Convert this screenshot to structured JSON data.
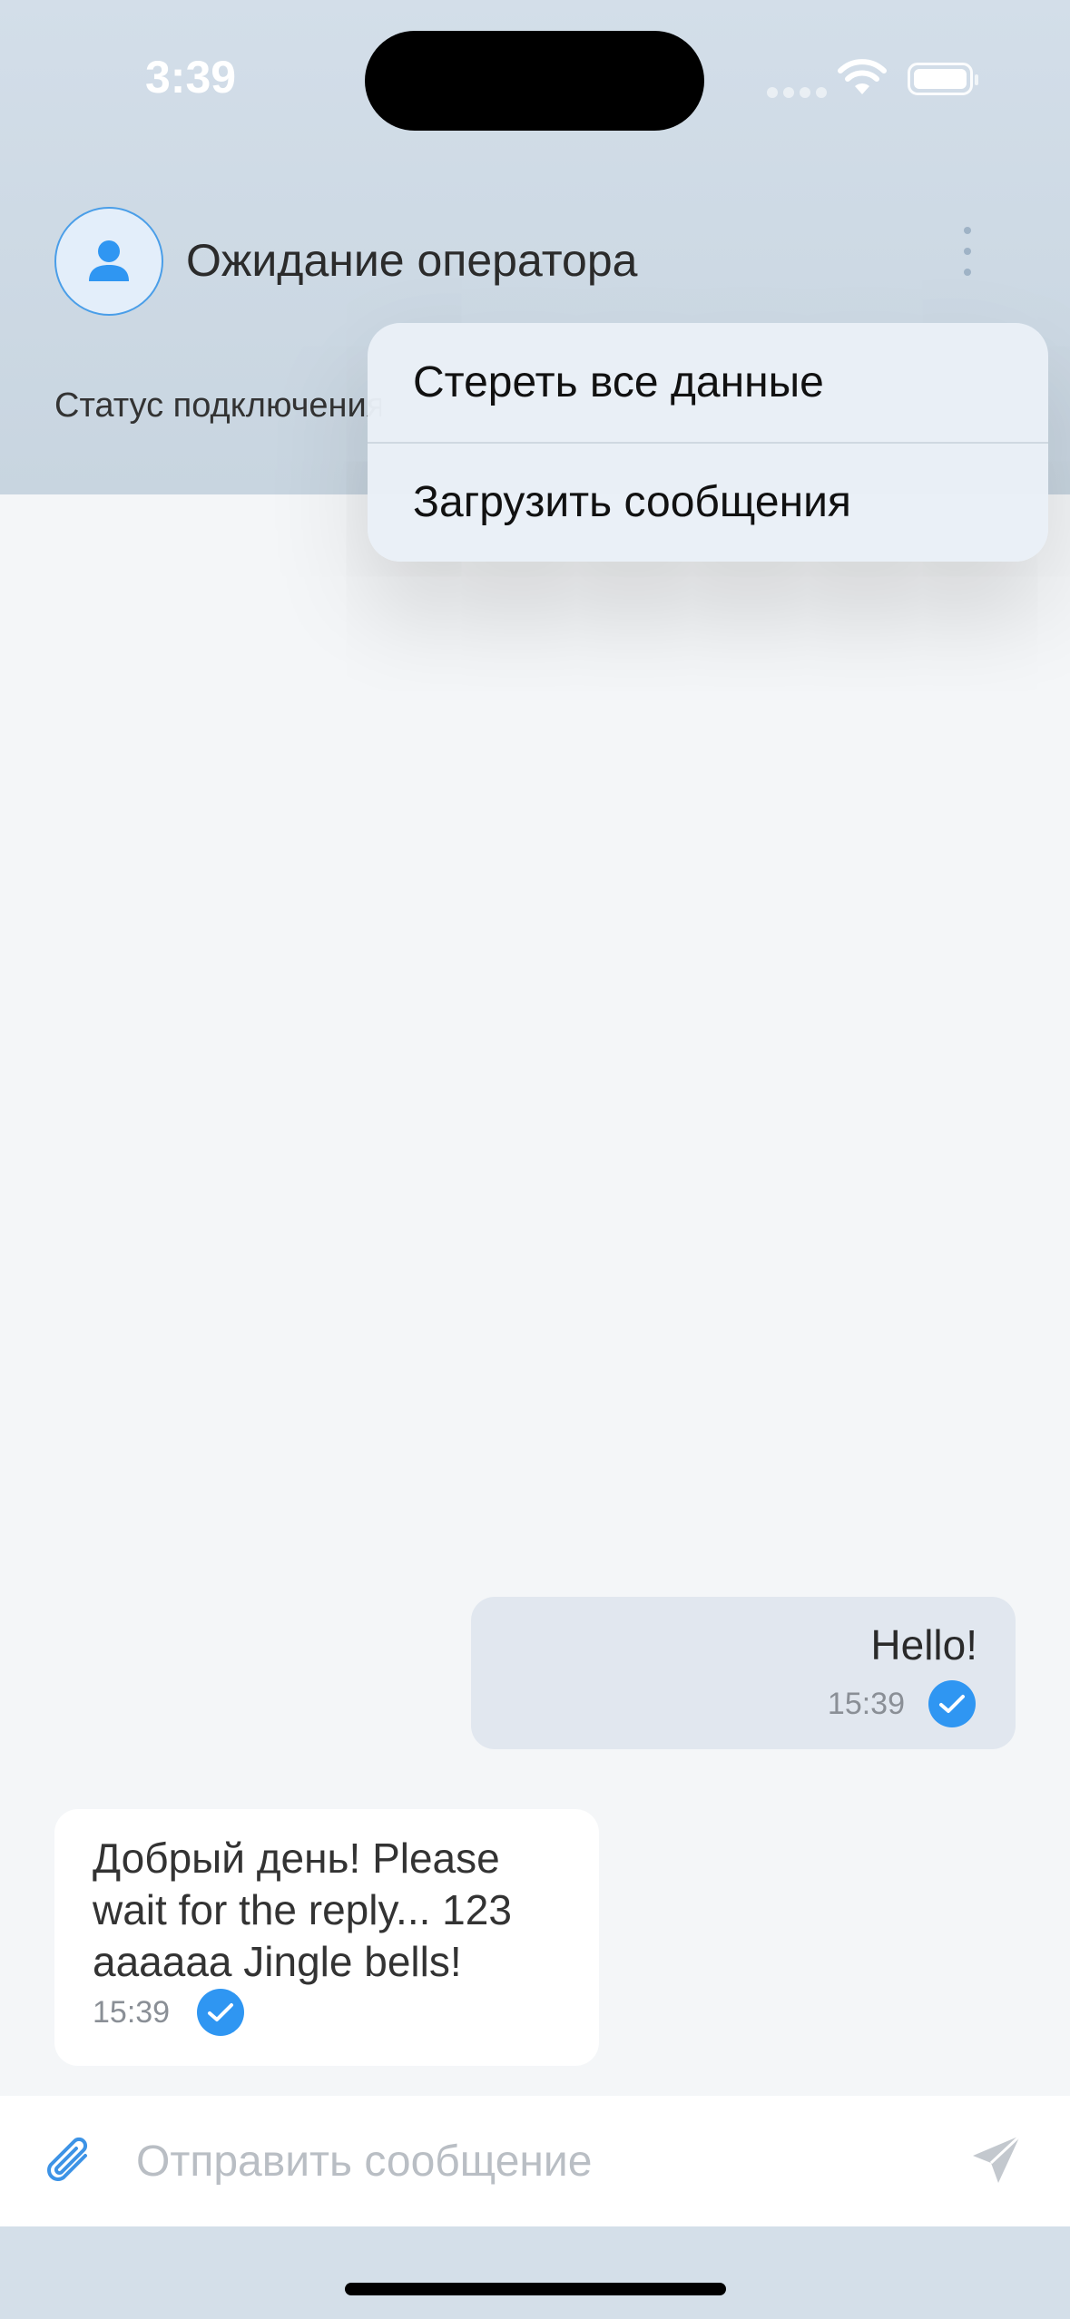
{
  "status_bar": {
    "time": "3:39"
  },
  "header": {
    "title": "Ожидание оператора",
    "connection_status": "Статус подключения"
  },
  "menu": {
    "items": [
      {
        "label": "Стереть все данные"
      },
      {
        "label": "Загрузить сообщения"
      }
    ]
  },
  "messages": [
    {
      "direction": "outgoing",
      "text": "Hello!",
      "time": "15:39",
      "status": "delivered"
    },
    {
      "direction": "incoming",
      "text": "Добрый день! Please wait for the reply... 123 aaaaaa Jingle bells!",
      "time": "15:39",
      "status": "delivered"
    }
  ],
  "composer": {
    "placeholder": "Отправить сообщение",
    "value": ""
  },
  "colors": {
    "accent": "#2f96f2",
    "header_bg": "#d3dee9",
    "outgoing_bubble": "#e1e7ef",
    "incoming_bubble": "#ffffff"
  },
  "icons": {
    "avatar": "person-icon",
    "menu": "more-vertical-icon",
    "attach": "paperclip-icon",
    "send": "paper-plane-icon",
    "status": "check-circle-icon"
  }
}
